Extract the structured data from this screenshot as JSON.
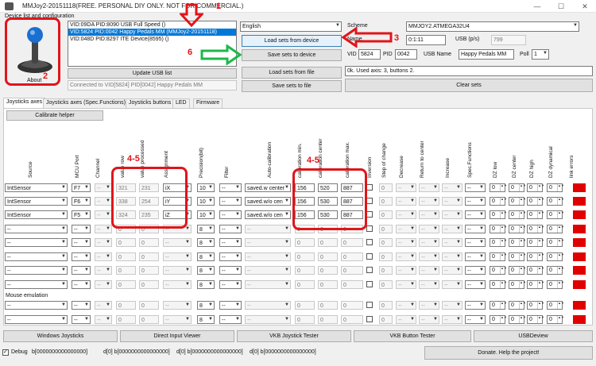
{
  "window": {
    "title": "MMJoy2-20151118(FREE. PERSONAL DIY ONLY. NOT FOR COMMERCIAL.)",
    "minimize": "—",
    "maximize": "☐",
    "close": "✕"
  },
  "device_group": {
    "label": "Device list and configuration",
    "about_label": "About"
  },
  "device_list": [
    "VID:09DA PID:8090 USB Full Speed ()",
    "VID:5824 PID:0042 Happy Pedals MM (MMJoy2-20151118)",
    "VID:048D PID:8297 ITE Device(8595) ()"
  ],
  "device_selected_index": 1,
  "buttons": {
    "update_usb": "Update USB list",
    "load_from_device": "Load sets from device",
    "save_to_device": "Save sets to device",
    "load_from_file": "Load sets from file",
    "save_to_file": "Save sets to file",
    "clear_sets": "Clear sets",
    "calibrate_helper": "Calibrate helper",
    "windows_joysticks": "Windows Joysticks",
    "direct_input": "Direct Input Viewer",
    "vkb_joystick": "VKB Joystick Tester",
    "vkb_button": "VKB Button Tester",
    "usbdeview": "USBDeview",
    "donate": "Donate. Help the project!"
  },
  "connected_text": "Connected to VID[5824] PID[0042] Happy Pedals MM",
  "language": "English",
  "scheme": {
    "label": "Scheme",
    "value": "MMJOY2.ATMEGA32U4"
  },
  "name": {
    "label": "Name",
    "value": "0:1:11"
  },
  "usb_ps": {
    "label": "USB (p/s)",
    "value": "799"
  },
  "vid": {
    "label": "VID",
    "value": "5824"
  },
  "pid": {
    "label": "PID",
    "value": "0042"
  },
  "usb_name": {
    "label": "USB Name",
    "value": "Happy Pedals MM"
  },
  "poll": {
    "label": "Poll",
    "value": "1"
  },
  "status_text": "0k. Used axis: 3, buttons 2.",
  "tabs": [
    "Joysticks axes",
    "Joysticks axes (Spec.Functions)",
    "Joysticks buttons",
    "LED",
    "Firmware"
  ],
  "active_tab": 0,
  "columns": [
    "Source",
    "MCU Port",
    "Channel",
    "value row",
    "value processed",
    "Assignment",
    "Precision(bit)",
    "Filter",
    "Auto-calibration",
    "calibration min.",
    "calibration center",
    "calibration max.",
    "Inversion",
    "Step of change",
    "Decrease",
    "Return to center",
    "Increase",
    "Spec.Functions",
    "DZ low",
    "DZ center",
    "DZ high",
    "DZ dynamical",
    "link errors"
  ],
  "rows": [
    {
      "source": "IntSensor",
      "port": "F7",
      "channel": "--",
      "raw": "321",
      "proc": "231",
      "assign": "iX",
      "prec": "10",
      "filter": "--",
      "auto": "saved.w center",
      "cmin": "156",
      "ccen": "520",
      "cmax": "887",
      "step": "0",
      "dec": "--",
      "ret": "--",
      "inc": "--",
      "spec": "--",
      "dzl": "0",
      "dzc": "0",
      "dzh": "0",
      "dzd": "0"
    },
    {
      "source": "IntSensor",
      "port": "F6",
      "channel": "--",
      "raw": "338",
      "proc": "254",
      "assign": "iY",
      "prec": "10",
      "filter": "--",
      "auto": "saved.w/o cen",
      "cmin": "156",
      "ccen": "530",
      "cmax": "887",
      "step": "0",
      "dec": "--",
      "ret": "--",
      "inc": "--",
      "spec": "--",
      "dzl": "0",
      "dzc": "0",
      "dzh": "0",
      "dzd": "0"
    },
    {
      "source": "IntSensor",
      "port": "F5",
      "channel": "--",
      "raw": "324",
      "proc": "235",
      "assign": "iZ",
      "prec": "10",
      "filter": "--",
      "auto": "saved.w/o cen",
      "cmin": "156",
      "ccen": "530",
      "cmax": "887",
      "step": "0",
      "dec": "--",
      "ret": "--",
      "inc": "--",
      "spec": "--",
      "dzl": "0",
      "dzc": "0",
      "dzh": "0",
      "dzd": "0"
    },
    {
      "source": "--",
      "port": "--",
      "channel": "--",
      "raw": "0",
      "proc": "0",
      "assign": "--",
      "prec": "8",
      "filter": "--",
      "auto": "--",
      "cmin": "0",
      "ccen": "0",
      "cmax": "0",
      "step": "0",
      "dec": "--",
      "ret": "--",
      "inc": "--",
      "spec": "--",
      "dzl": "0",
      "dzc": "0",
      "dzh": "0",
      "dzd": "0"
    },
    {
      "source": "--",
      "port": "--",
      "channel": "--",
      "raw": "0",
      "proc": "0",
      "assign": "--",
      "prec": "8",
      "filter": "--",
      "auto": "--",
      "cmin": "0",
      "ccen": "0",
      "cmax": "0",
      "step": "0",
      "dec": "--",
      "ret": "--",
      "inc": "--",
      "spec": "--",
      "dzl": "0",
      "dzc": "0",
      "dzh": "0",
      "dzd": "0"
    },
    {
      "source": "--",
      "port": "--",
      "channel": "--",
      "raw": "0",
      "proc": "0",
      "assign": "--",
      "prec": "8",
      "filter": "--",
      "auto": "--",
      "cmin": "0",
      "ccen": "0",
      "cmax": "0",
      "step": "0",
      "dec": "--",
      "ret": "--",
      "inc": "--",
      "spec": "--",
      "dzl": "0",
      "dzc": "0",
      "dzh": "0",
      "dzd": "0"
    },
    {
      "source": "--",
      "port": "--",
      "channel": "--",
      "raw": "0",
      "proc": "0",
      "assign": "--",
      "prec": "8",
      "filter": "--",
      "auto": "--",
      "cmin": "0",
      "ccen": "0",
      "cmax": "0",
      "step": "0",
      "dec": "--",
      "ret": "--",
      "inc": "--",
      "spec": "--",
      "dzl": "0",
      "dzc": "0",
      "dzh": "0",
      "dzd": "0"
    },
    {
      "source": "--",
      "port": "--",
      "channel": "--",
      "raw": "0",
      "proc": "0",
      "assign": "--",
      "prec": "8",
      "filter": "--",
      "auto": "--",
      "cmin": "0",
      "ccen": "0",
      "cmax": "0",
      "step": "0",
      "dec": "--",
      "ret": "--",
      "inc": "--",
      "spec": "--",
      "dzl": "0",
      "dzc": "0",
      "dzh": "0",
      "dzd": "0"
    }
  ],
  "mouse_label": "Mouse emulation",
  "mouse_rows": [
    {
      "source": "--",
      "port": "--",
      "channel": "--",
      "raw": "0",
      "proc": "0",
      "assign": "--",
      "prec": "8",
      "filter": "--",
      "auto": "--",
      "cmin": "0",
      "ccen": "0",
      "cmax": "0",
      "step": "0",
      "dec": "--",
      "ret": "--",
      "inc": "--",
      "spec": "--",
      "dzl": "0",
      "dzc": "0",
      "dzh": "0",
      "dzd": "0"
    },
    {
      "source": "--",
      "port": "--",
      "channel": "--",
      "raw": "0",
      "proc": "0",
      "assign": "--",
      "prec": "8",
      "filter": "--",
      "auto": "--",
      "cmin": "0",
      "ccen": "0",
      "cmax": "0",
      "step": "0",
      "dec": "--",
      "ret": "--",
      "inc": "--",
      "spec": "--",
      "dzl": "0",
      "dzc": "0",
      "dzh": "0",
      "dzd": "0"
    }
  ],
  "debug": {
    "label": "Debug",
    "fields": [
      "b[0000000000000000]",
      "d[0] b[0000000000000000]",
      "d[0] b[0000000000000000]",
      "d[0] b[0000000000000000]"
    ]
  },
  "annotations": {
    "a1": "1",
    "a2": "2",
    "a3": "3",
    "a4a": "4-5",
    "a4b": "4-5",
    "a6": "6"
  },
  "colors": {
    "accent": "#0078d7",
    "annotation_red": "#e0151a",
    "annotation_green": "#1db84a",
    "error_red": "#e00000"
  }
}
